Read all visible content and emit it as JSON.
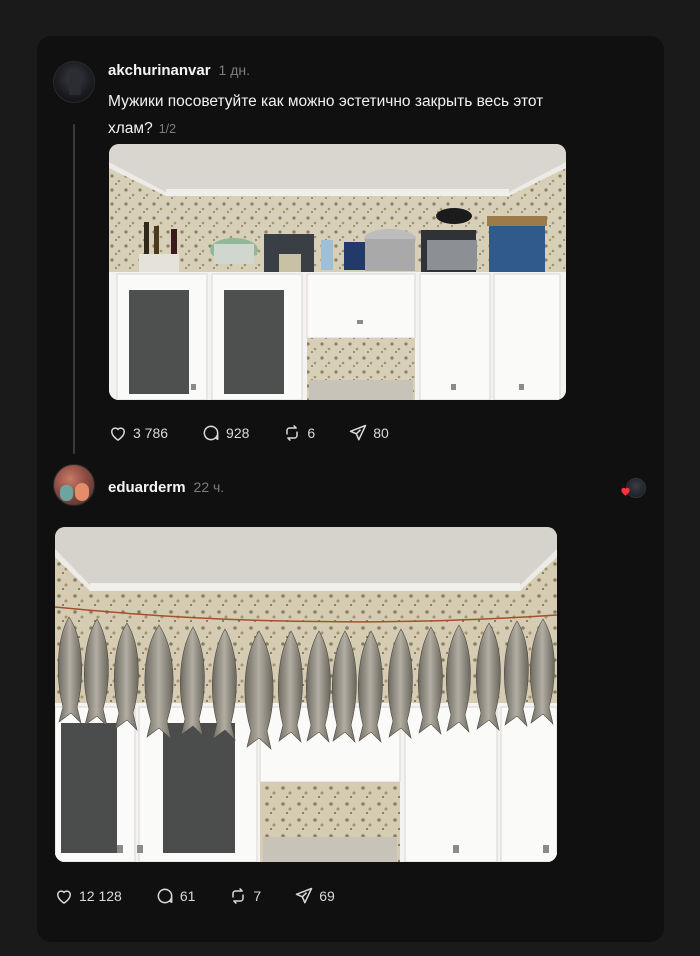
{
  "posts": [
    {
      "username": "akchurinanvar",
      "time": "1 дн.",
      "text": "Мужики посоветуйте как можно эстетично закрыть весь этот хлам?",
      "page_count": "1/2",
      "avatar_icon": "user-avatar",
      "stats": {
        "likes": "3 786",
        "comments": "928",
        "reposts": "6",
        "shares": "80"
      }
    },
    {
      "username": "eduarderm",
      "time": "22 ч.",
      "avatar_icon": "user-avatar",
      "stats": {
        "likes": "12 128",
        "comments": "61",
        "reposts": "7",
        "shares": "69"
      }
    }
  ],
  "icons": {
    "like": "heart-icon",
    "comment": "comment-bubble-icon",
    "repost": "repost-icon",
    "share": "send-icon",
    "liked_by": "red-heart-icon"
  },
  "colors": {
    "background": "#1a1a1a",
    "card": "#101010",
    "text_primary": "#f3f3f3",
    "text_secondary": "#7d7d7d",
    "heart_red": "#ff3040"
  }
}
